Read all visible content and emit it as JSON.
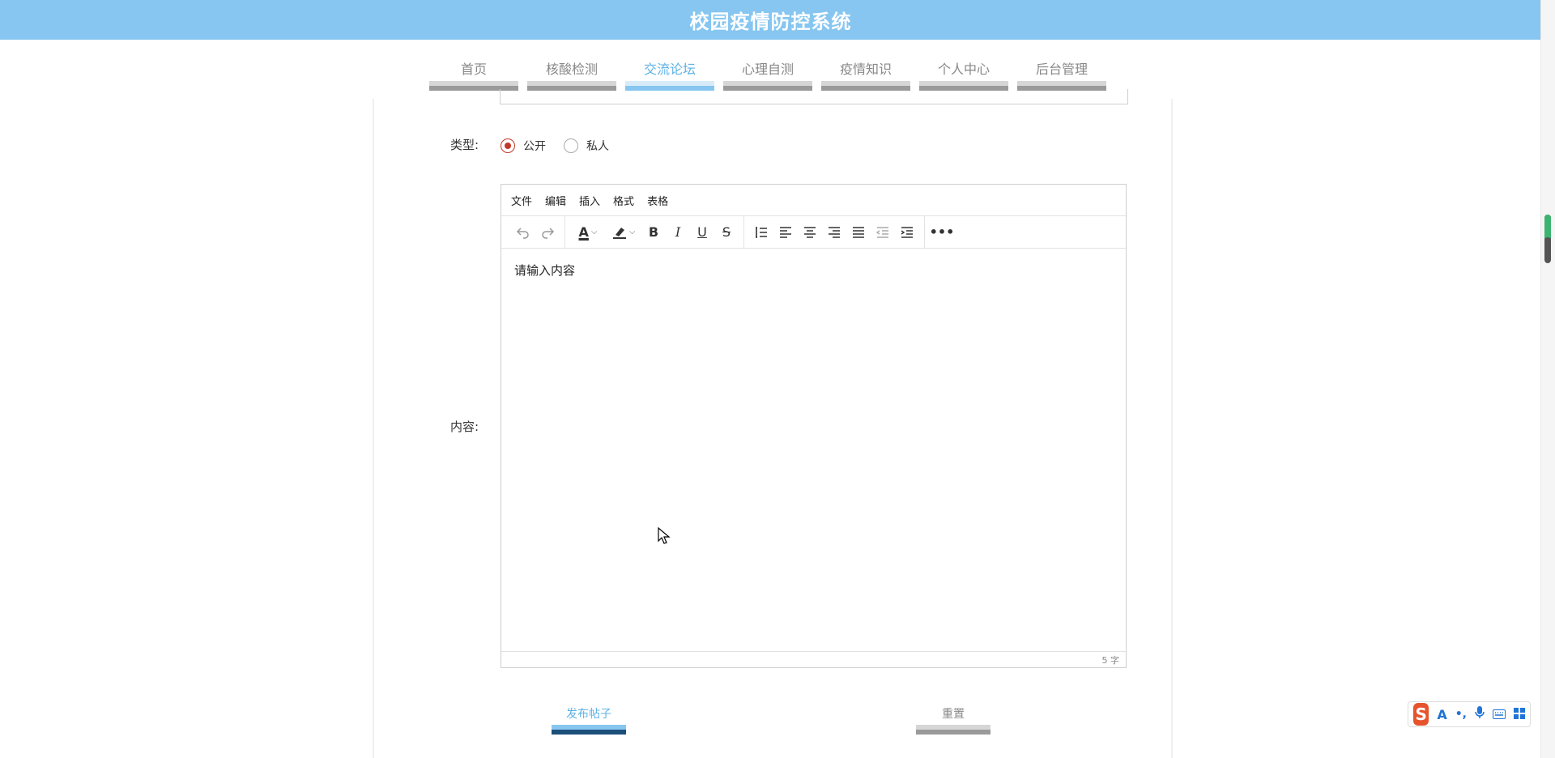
{
  "header": {
    "title": "校园疫情防控系统"
  },
  "nav": {
    "items": [
      {
        "label": "首页"
      },
      {
        "label": "核酸检测"
      },
      {
        "label": "交流论坛"
      },
      {
        "label": "心理自测"
      },
      {
        "label": "疫情知识"
      },
      {
        "label": "个人中心"
      },
      {
        "label": "后台管理"
      }
    ],
    "active_index": 2
  },
  "form": {
    "type_label": "类型:",
    "content_label": "内容:",
    "type_options": [
      {
        "label": "公开",
        "checked": true
      },
      {
        "label": "私人",
        "checked": false
      }
    ],
    "editor": {
      "menu": [
        "文件",
        "编辑",
        "插入",
        "格式",
        "表格"
      ],
      "placeholder": "请输入内容",
      "word_count": "5 字"
    },
    "submit_label": "发布帖子",
    "reset_label": "重置"
  },
  "colors": {
    "header_bg": "#86c6f0",
    "accent": "#5db2e8",
    "radio_checked": "#c0392b"
  }
}
